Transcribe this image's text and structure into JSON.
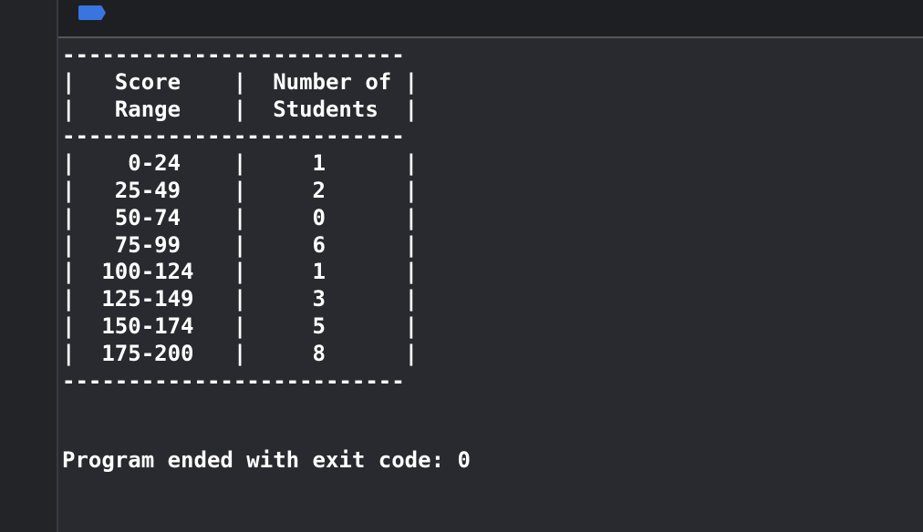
{
  "console": {
    "separator": "--------------------------",
    "header": [
      "|   Score    |  Number of |",
      "|   Range    |  Students  |"
    ],
    "rows": [
      "|    0-24    |     1      |",
      "|   25-49    |     2      |",
      "|   50-74    |     0      |",
      "|   75-99    |     6      |",
      "|  100-124   |     1      |",
      "|  125-149   |     3      |",
      "|  150-174   |     5      |",
      "|  175-200   |     8      |"
    ],
    "exit_message": "Program ended with exit code: 0"
  },
  "colors": {
    "background": "#292a30",
    "toolbar": "#1e1f23",
    "gutter": "#232428",
    "text": "#ffffff",
    "accent": "#3a74e0"
  },
  "icons": {
    "toolbar_tag": "tag-icon"
  }
}
